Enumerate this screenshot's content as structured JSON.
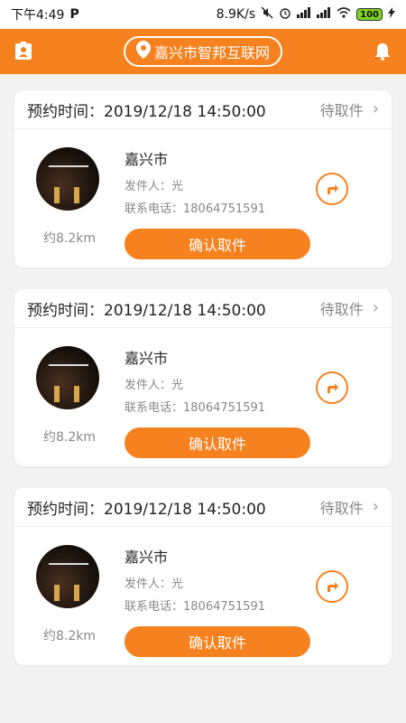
{
  "status_bar": {
    "time": "下午4:49",
    "carrier_icon": "P",
    "net_speed": "8.9K/s",
    "battery": "100"
  },
  "header": {
    "location": "嘉兴市智邦互联网"
  },
  "labels": {
    "reserve_prefix": "预约时间：",
    "sender_prefix": "发件人：",
    "phone_prefix": "联系电话："
  },
  "cards": [
    {
      "reserve_time": "2019/12/18 14:50:00",
      "status": "待取件",
      "city": "嘉兴市",
      "sender": "光",
      "phone": "18064751591",
      "distance": "约8.2km",
      "confirm": "确认取件"
    },
    {
      "reserve_time": "2019/12/18 14:50:00",
      "status": "待取件",
      "city": "嘉兴市",
      "sender": "光",
      "phone": "18064751591",
      "distance": "约8.2km",
      "confirm": "确认取件"
    },
    {
      "reserve_time": "2019/12/18 14:50:00",
      "status": "待取件",
      "city": "嘉兴市",
      "sender": "光",
      "phone": "18064751591",
      "distance": "约8.2km",
      "confirm": "确认取件"
    }
  ],
  "colors": {
    "accent": "#f5821f",
    "background": "#f2f2f2"
  }
}
